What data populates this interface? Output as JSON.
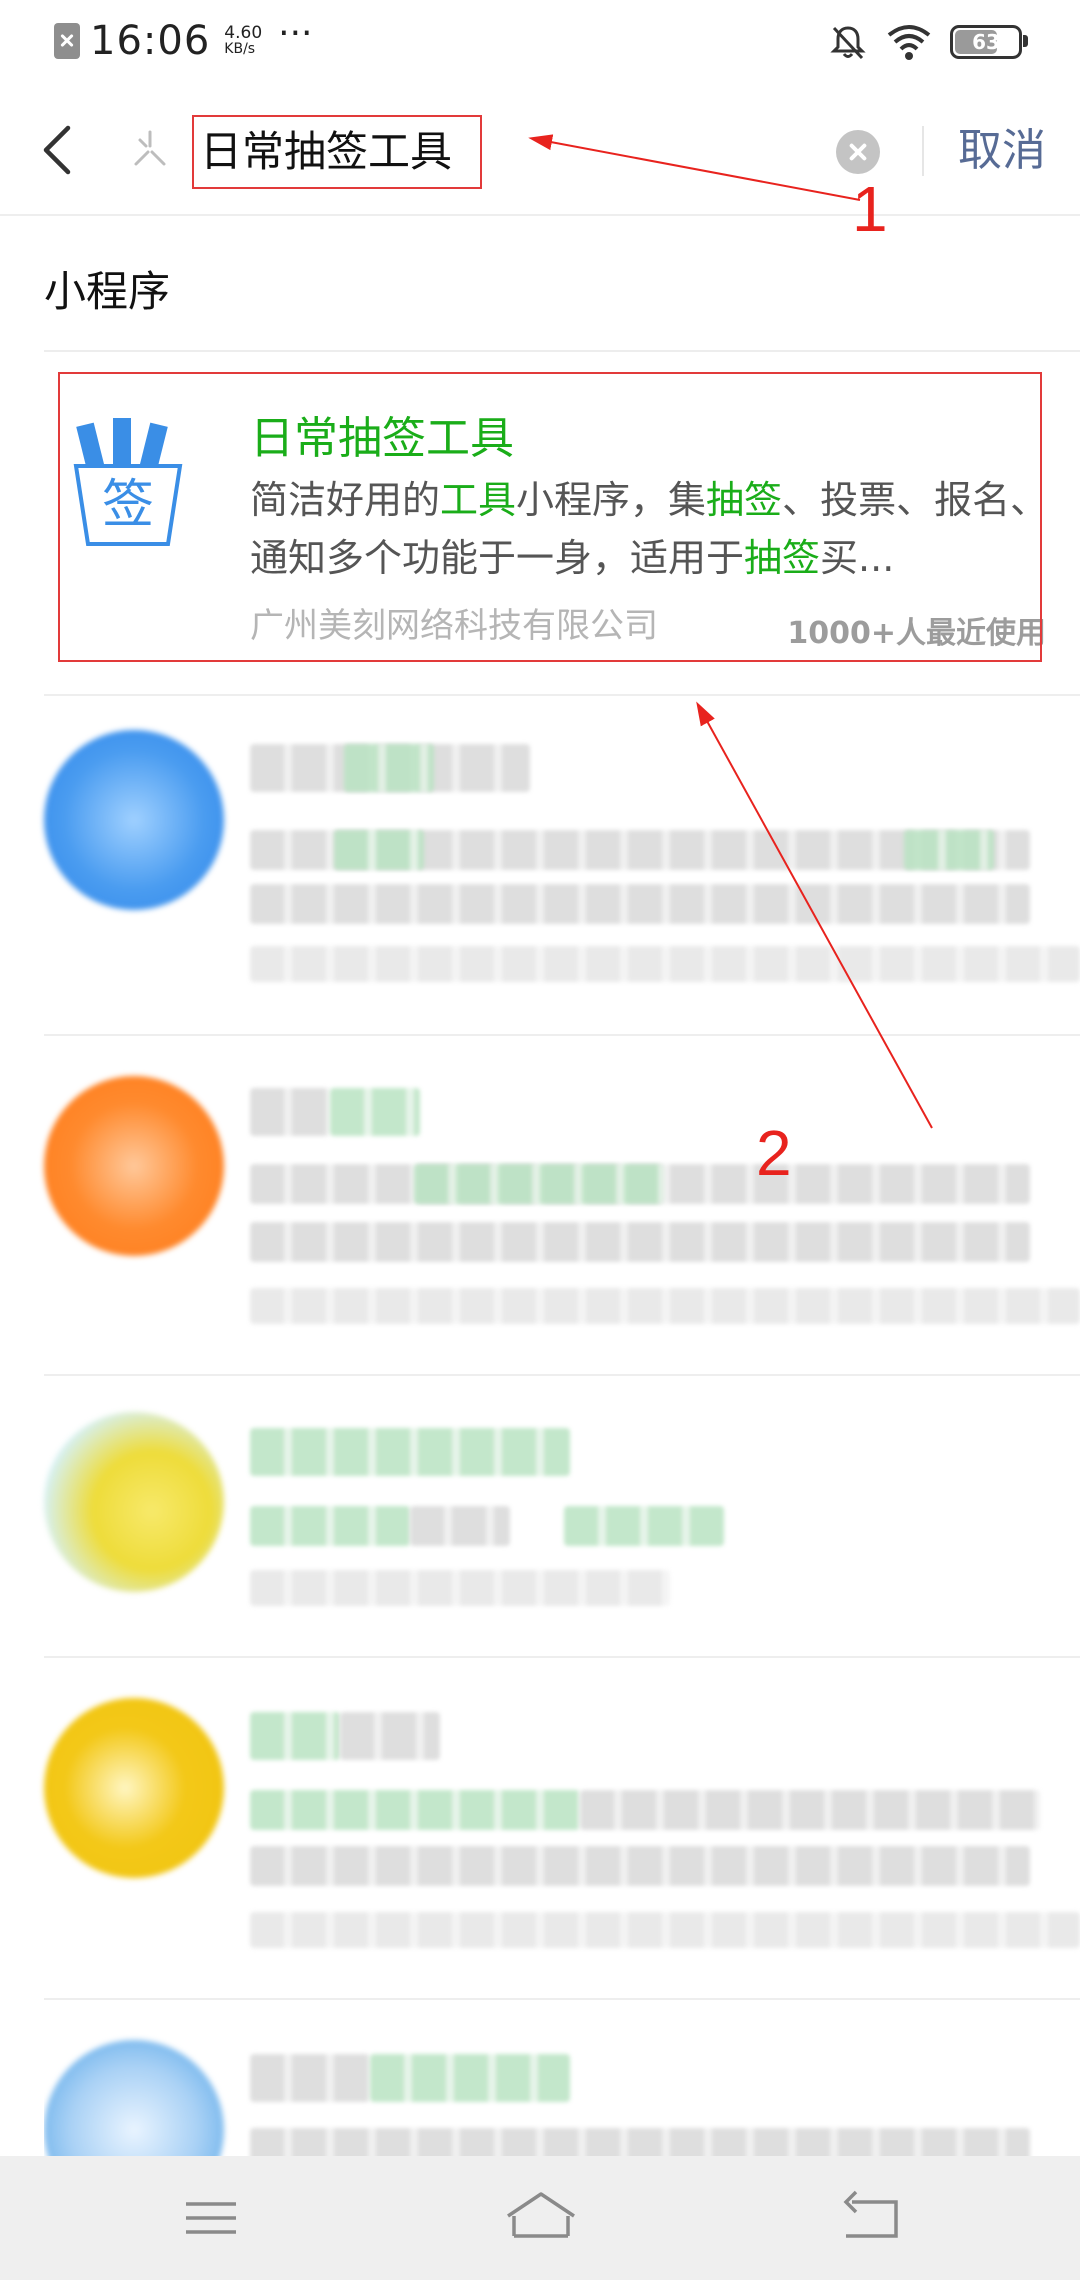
{
  "status_bar": {
    "time": "16:06",
    "net_speed_value": "4.60",
    "net_speed_unit": "KB/s",
    "more": "···",
    "battery_level": "63",
    "battery_fraction": 0.63
  },
  "search": {
    "query": "日常抽签工具",
    "cancel_label": "取消"
  },
  "section": {
    "title": "小程序"
  },
  "results": [
    {
      "title": "日常抽签工具",
      "desc_parts": [
        {
          "text": "简洁好用的",
          "hl": false
        },
        {
          "text": "工具",
          "hl": true
        },
        {
          "text": "小程序，集",
          "hl": false
        },
        {
          "text": "抽签",
          "hl": true
        },
        {
          "text": "、投票、报名、通知多个功能于一身，适用于",
          "hl": false
        },
        {
          "text": "抽签",
          "hl": true
        },
        {
          "text": "买...",
          "hl": false
        }
      ],
      "company": "广州美刻网络科技有限公司",
      "usage": "1000+人最近使用",
      "icon_char": "签"
    }
  ],
  "annotations": {
    "label_1": "1",
    "label_2": "2",
    "color": "#e8231e"
  },
  "colors": {
    "accent_green": "#1aad19",
    "link_blue": "#576b95"
  }
}
